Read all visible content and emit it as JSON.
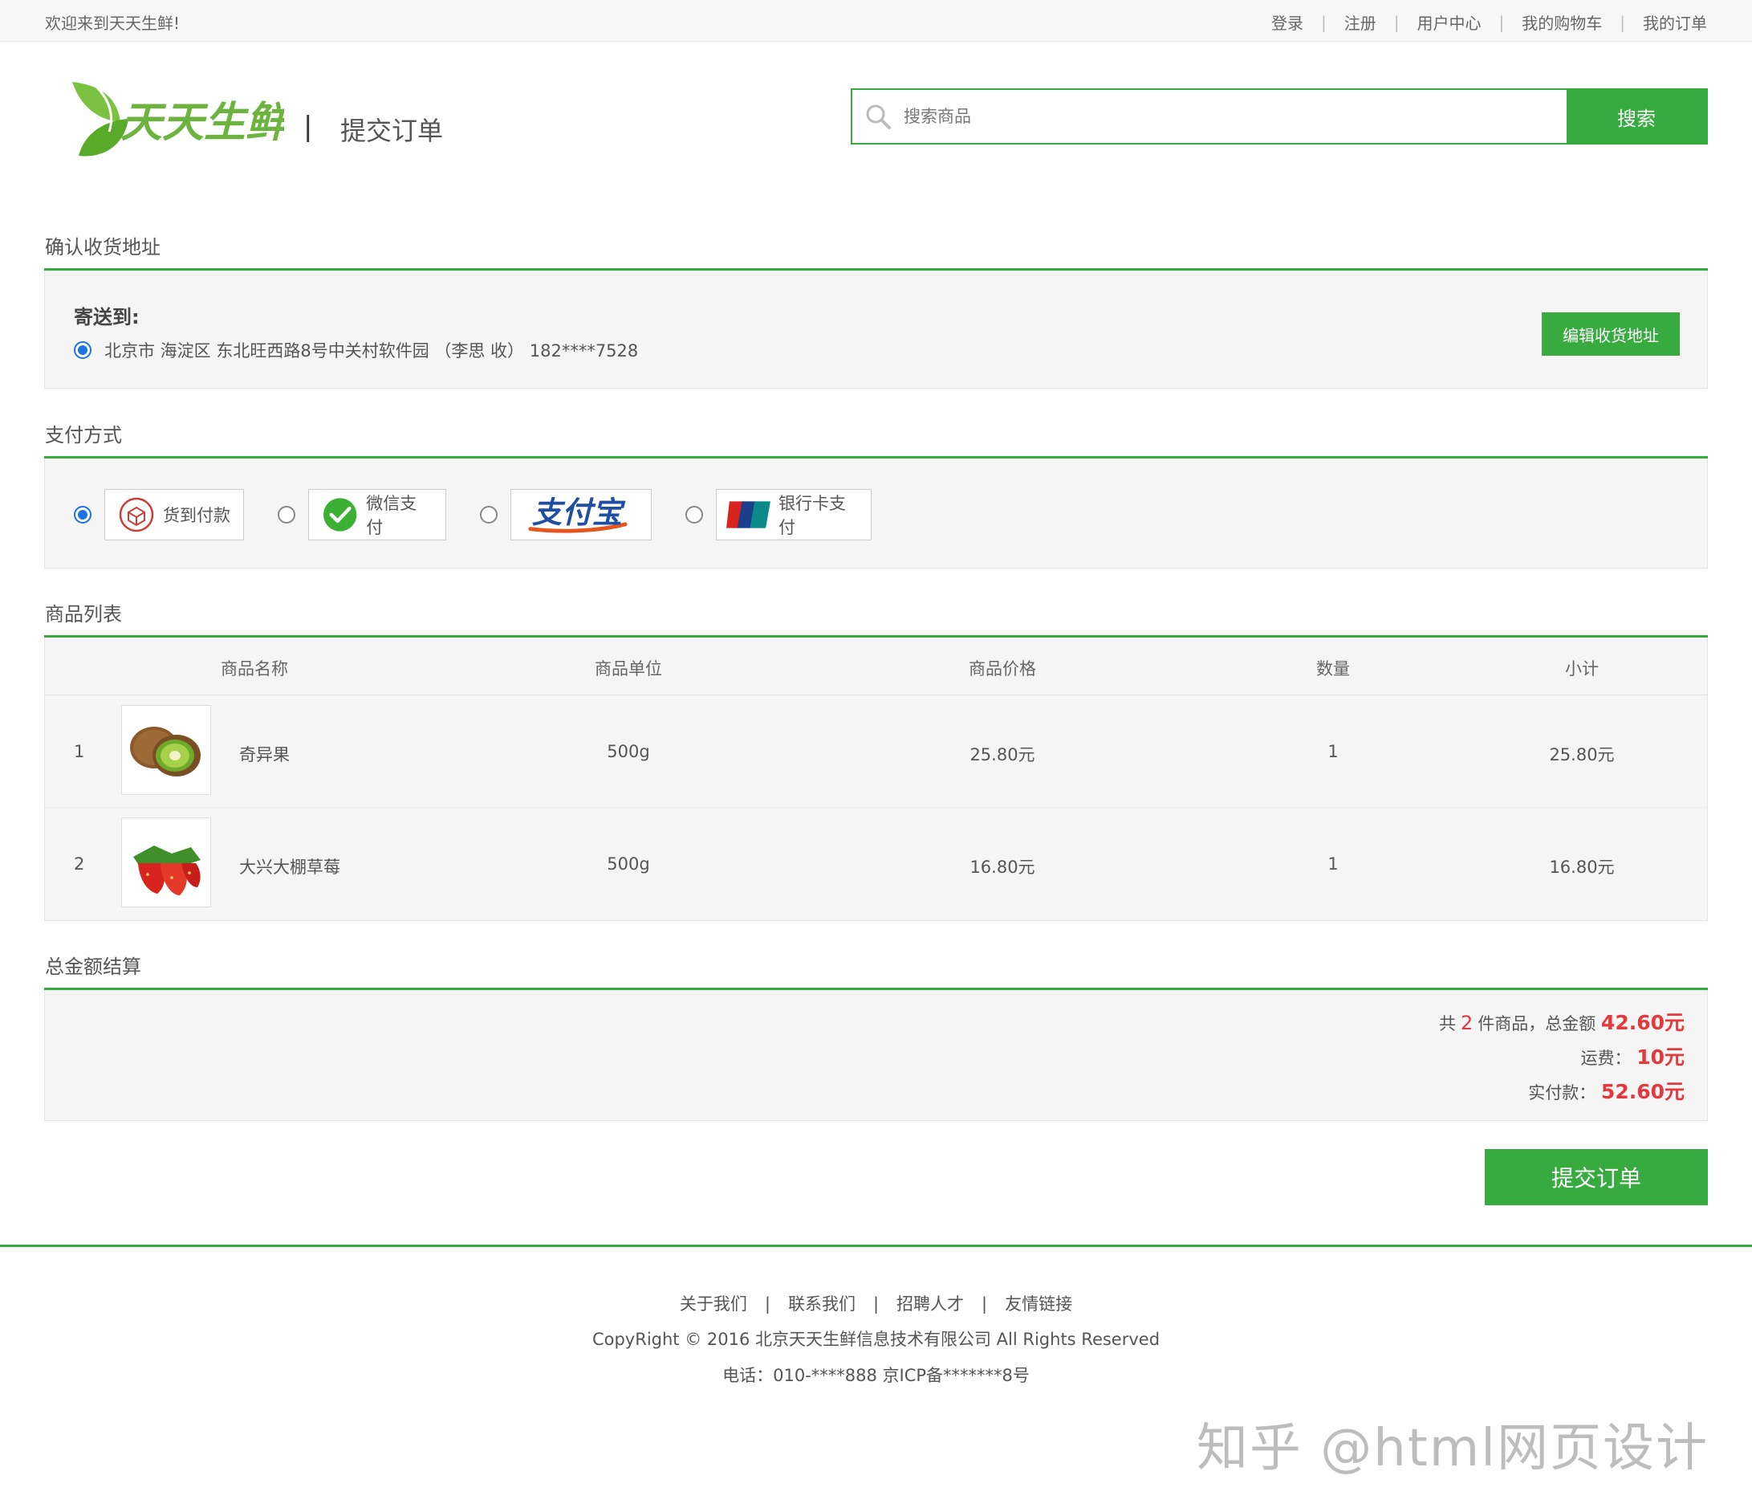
{
  "topbar": {
    "welcome": "欢迎来到天天生鲜!",
    "links": [
      "登录",
      "注册",
      "用户中心",
      "我的购物车",
      "我的订单"
    ]
  },
  "header": {
    "logo_text": "天天生鲜",
    "divider": "|",
    "page_title": "提交订单",
    "search_placeholder": "搜索商品",
    "search_button": "搜索"
  },
  "address": {
    "section_title": "确认收货地址",
    "label": "寄送到:",
    "value": "北京市 海淀区 东北旺西路8号中关村软件园 （李思 收） 182****7528",
    "edit_button": "编辑收货地址"
  },
  "payment": {
    "section_title": "支付方式",
    "options": [
      {
        "label": "货到付款",
        "icon": "cash-on-delivery-icon",
        "checked": true
      },
      {
        "label": "微信支付",
        "icon": "wechat-pay-icon",
        "checked": false
      },
      {
        "label": "支付宝",
        "icon": "alipay-logo",
        "checked": false
      },
      {
        "label": "银行卡支付",
        "icon": "unionpay-icon",
        "checked": false
      }
    ]
  },
  "goods": {
    "section_title": "商品列表",
    "headers": [
      "商品名称",
      "商品单位",
      "商品价格",
      "数量",
      "小计"
    ],
    "rows": [
      {
        "index": "1",
        "name": "奇异果",
        "unit": "500g",
        "price": "25.80元",
        "qty": "1",
        "subtotal": "25.80元",
        "image": "kiwi-image"
      },
      {
        "index": "2",
        "name": "大兴大棚草莓",
        "unit": "500g",
        "price": "16.80元",
        "qty": "1",
        "subtotal": "16.80元",
        "image": "strawberry-image"
      }
    ]
  },
  "totals": {
    "section_title": "总金额结算",
    "count_prefix": "共",
    "count": "2",
    "count_suffix": "件商品，总金额",
    "total": "42.60元",
    "shipping_label": "运费：",
    "shipping": "10元",
    "pay_label": "实付款：",
    "pay": "52.60元"
  },
  "submit_button": "提交订单",
  "footer": {
    "links": [
      "关于我们",
      "联系我们",
      "招聘人才",
      "友情链接"
    ],
    "copyright": "CopyRight © 2016 北京天天生鲜信息技术有限公司 All Rights Reserved",
    "phone": "电话：010-****888 京ICP备*******8号"
  },
  "watermark": "知乎 @html网页设计",
  "colors": {
    "accent": "#37ab40",
    "price": "#e4393c",
    "radio": "#1a73e8"
  }
}
